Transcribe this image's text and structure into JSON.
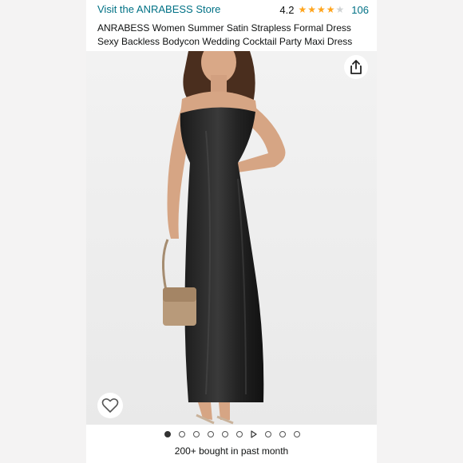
{
  "header": {
    "store_link": "Visit the ANRABESS Store",
    "rating_value": "4.2",
    "rating_stars": 4.2,
    "rating_count": "106"
  },
  "product": {
    "title_line1": "ANRABESS Women Summer Satin Strapless Formal Dress",
    "title_line2": "Sexy Backless Bodycon Wedding Cocktail Party Maxi Dress"
  },
  "gallery": {
    "image_icon": "product-photo",
    "share_icon": "share-icon",
    "favorite_icon": "heart-icon",
    "thumbnail_count": 10,
    "active_index": 0,
    "video_index": 6
  },
  "social_proof": {
    "bought_text": "200+ bought in past month"
  },
  "colors": {
    "link": "#007185",
    "star": "#ffa41c",
    "text": "#0f1111"
  }
}
